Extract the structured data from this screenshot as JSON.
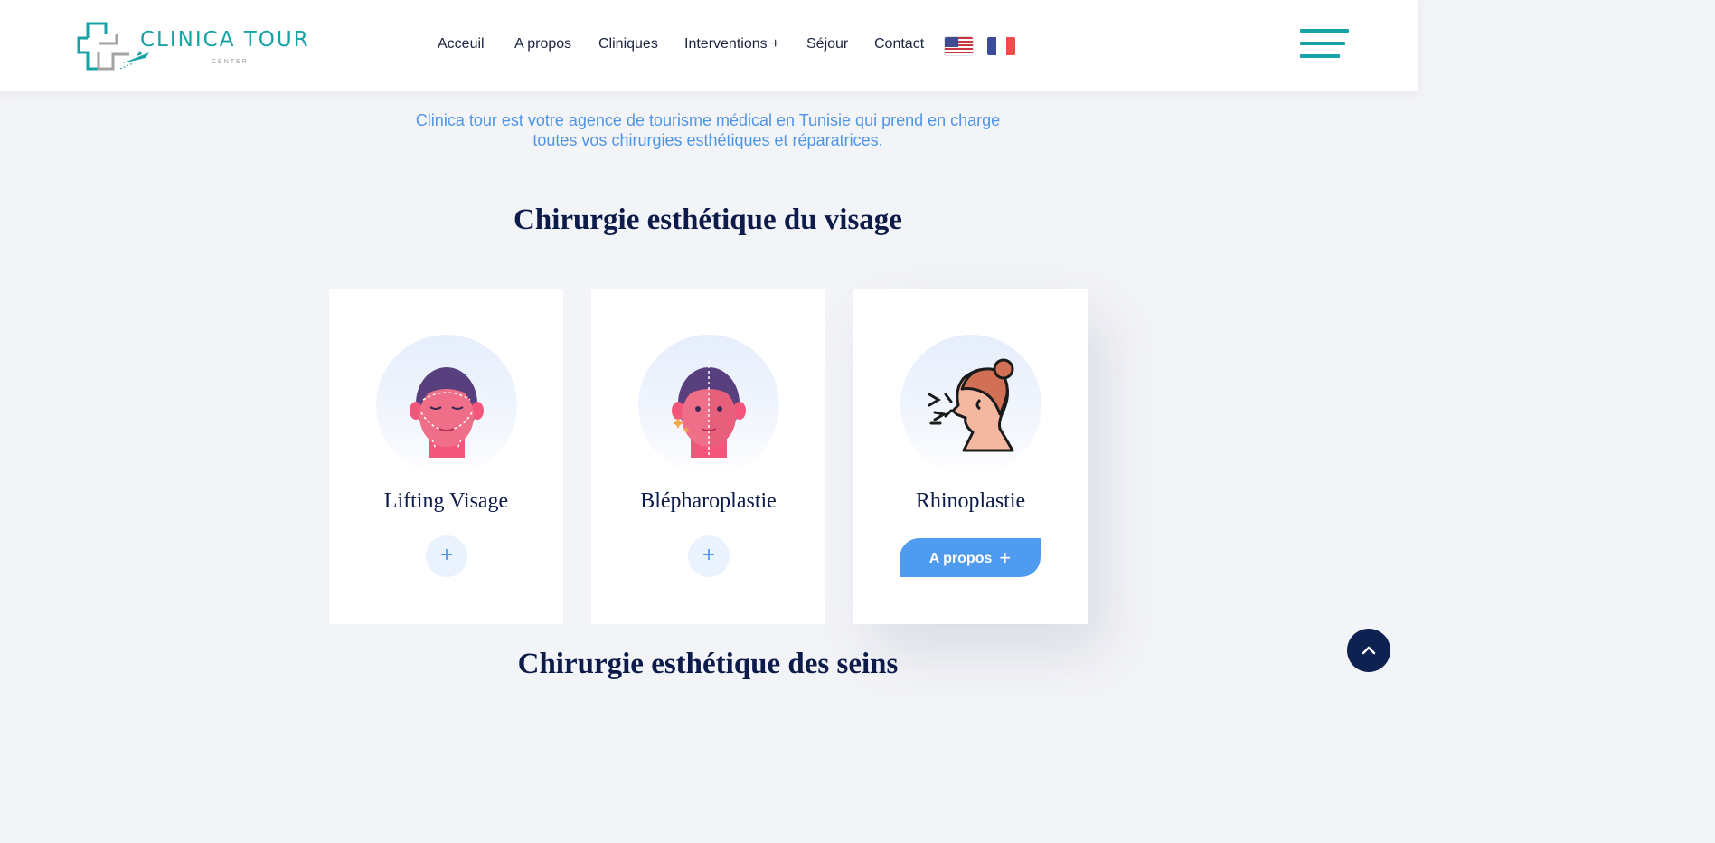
{
  "header": {
    "logo": {
      "title": "CLINICA TOUR",
      "subtitle": "CENTER"
    },
    "nav": [
      {
        "label": "Acceuil"
      },
      {
        "label": "A propos"
      },
      {
        "label": "Cliniques"
      },
      {
        "label": "Interventions +"
      },
      {
        "label": "Séjour"
      },
      {
        "label": "Contact"
      }
    ],
    "languages": [
      "us-flag-icon",
      "fr-flag-icon"
    ],
    "menu_icon": "hamburger-menu-icon"
  },
  "main": {
    "intro_line1": "Clinica tour est votre agence de tourisme médical en Tunisie qui prend en charge",
    "intro_line2": "toutes vos chirurgies esthétiques et réparatrices.",
    "section1_title": "Chirurgie esthétique du visage",
    "cards": [
      {
        "title": "Lifting Visage",
        "icon": "face-lift-icon",
        "button": "+"
      },
      {
        "title": "Blépharoplastie",
        "icon": "blepharoplasty-face-icon",
        "button": "+"
      },
      {
        "title": "Rhinoplastie",
        "icon": "rhinoplasty-profile-icon",
        "button": "A propos",
        "button_plus": "+"
      }
    ],
    "section2_title": "Chirurgie esthétique des seins"
  },
  "scroll_top_icon": "chevron-up-icon",
  "colors": {
    "brand_teal": "#17a2a6",
    "accent_blue": "#4f9bef",
    "navy": "#0d1b4a",
    "background": "#f3f4f8"
  }
}
